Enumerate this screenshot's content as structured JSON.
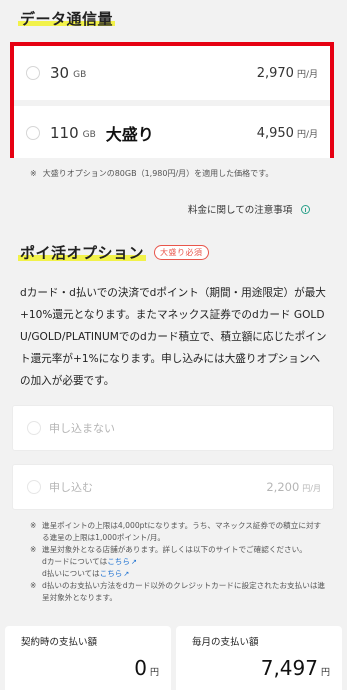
{
  "data_section": {
    "title": "データ通信量",
    "plans": [
      {
        "gb": "30",
        "unit": "GB",
        "badge": "",
        "price": "2,970",
        "price_unit": "円/月"
      },
      {
        "gb": "110",
        "unit": "GB",
        "badge": "大盛り",
        "price": "4,950",
        "price_unit": "円/月"
      }
    ],
    "note_mark": "※",
    "note": "大盛りオプションの80GB（1,980円/月）を適用した価格です。",
    "fee_link": "料金に関しての注意事項"
  },
  "poi_section": {
    "title": "ポイ活オプション",
    "badge": "大盛り必須",
    "description": "dカード・d払いでの決済でdポイント（期間・用途限定）が最大+10%還元となります。またマネックス証券でのdカード GOLD U/GOLD/PLATINUMでのdカード積立で、積立額に応じたポイント還元率が+1%になります。申し込みには大盛りオプションへの加入が必要です。",
    "options": [
      {
        "label": "申し込まない",
        "price": "",
        "price_unit": ""
      },
      {
        "label": "申し込む",
        "price": "2,200",
        "price_unit": "円/月"
      }
    ],
    "notes": [
      {
        "mark": "※",
        "text": "進呈ポイントの上限は4,000ptになります。うち、マネックス証券での積立に対する進呈の上限は1,000ポイント/月。"
      },
      {
        "mark": "※",
        "text": "進呈対象外となる店舗があります。詳しくは以下のサイトでご確認ください。"
      },
      {
        "mark": "",
        "text": "dカードについては",
        "link": "こちら"
      },
      {
        "mark": "",
        "text": "d払いについては",
        "link": "こちら"
      },
      {
        "mark": "※",
        "text": "d払いのお支払い方法をdカード以外のクレジットカードに設定されたお支払いは進呈対象外となります。"
      }
    ]
  },
  "footer": {
    "contract_label": "契約時の支払い額",
    "contract_value": "0",
    "contract_unit": "円",
    "monthly_label": "毎月の支払い額",
    "monthly_value": "7,497",
    "monthly_unit": "円"
  },
  "colors": {
    "highlight_box": "#e60012",
    "title_marker": "#f2f24a",
    "badge": "#e8554b",
    "link": "#1a6fd1",
    "info_icon": "#2aa08a"
  },
  "icons": [
    "radio-icon",
    "info-icon",
    "external-link-icon"
  ]
}
